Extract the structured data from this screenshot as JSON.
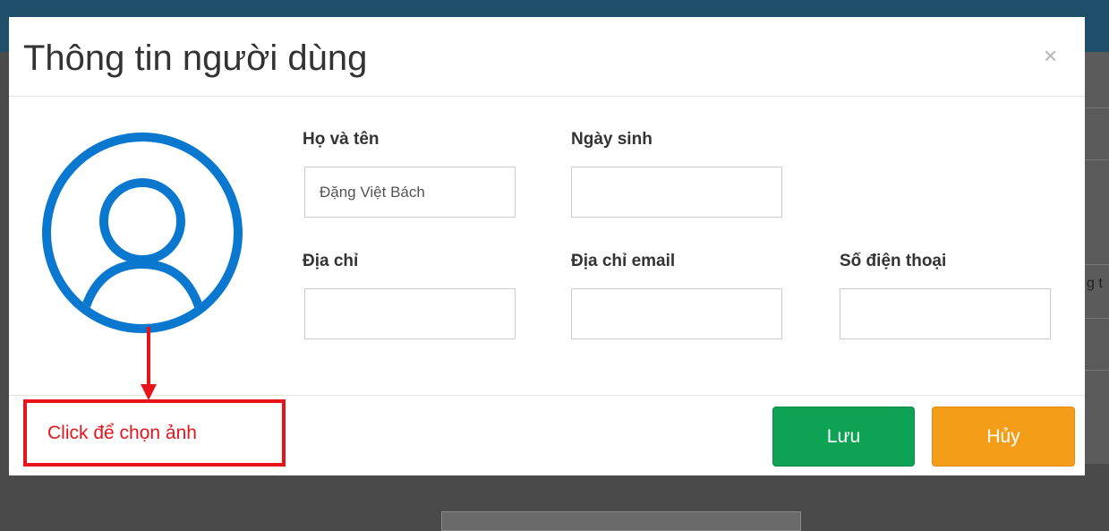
{
  "modal": {
    "title": "Thông tin người dùng",
    "close_symbol": "×"
  },
  "form": {
    "fullname": {
      "label": "Họ và tên",
      "value": "Đặng Việt Bách"
    },
    "birthday": {
      "label": "Ngày sinh",
      "value": ""
    },
    "address": {
      "label": "Địa chỉ",
      "value": ""
    },
    "email": {
      "label": "Địa chỉ email",
      "value": ""
    },
    "phone": {
      "label": "Số điện thoại",
      "value": ""
    }
  },
  "annotation": {
    "text": "Click để chọn ảnh"
  },
  "buttons": {
    "save": "Lưu",
    "cancel": "Hủy"
  },
  "background": {
    "fragment": "g t"
  },
  "colors": {
    "avatar": "#0b78d0",
    "annotation": "#e8141c",
    "save": "#0ea254",
    "cancel": "#f49d19"
  },
  "icons": {
    "avatar": "user-avatar-icon",
    "close": "close-icon",
    "arrow": "arrow-down-icon"
  }
}
